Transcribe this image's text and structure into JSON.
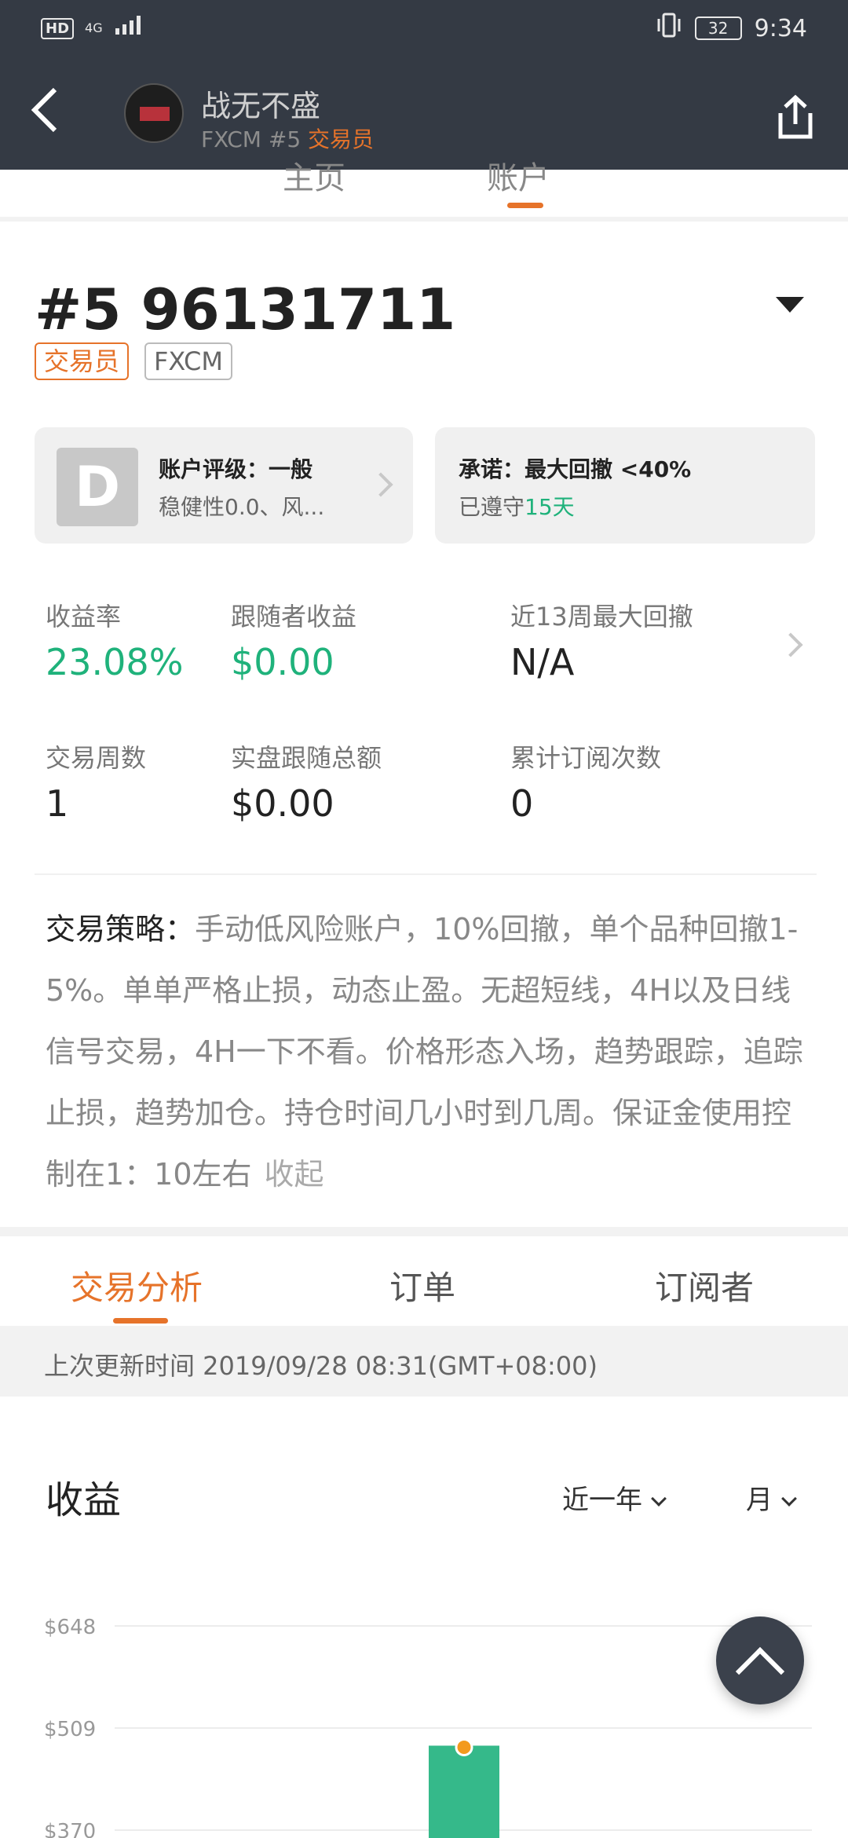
{
  "status_bar": {
    "network": "HD",
    "signal": "4G",
    "battery": "32",
    "time": "9:34"
  },
  "header": {
    "title": "战无不盛",
    "subtitle_prefix": "FXCM #5 ",
    "subtitle_role": "交易员",
    "back_icon": "chevron-left-icon",
    "share_icon": "share-icon"
  },
  "top_tabs": {
    "left_partial": "主页",
    "right_partial": "账户"
  },
  "account": {
    "id": "#5 96131711",
    "tags": [
      "交易员",
      "FXCM"
    ]
  },
  "rating_card": {
    "badge": "D",
    "title": "账户评级：一般",
    "subtitle": "稳健性0.0、风..."
  },
  "commitment_card": {
    "title": "承诺：最大回撤 <40%",
    "subtitle_prefix": "已遵守",
    "days": "15天"
  },
  "stats": [
    {
      "label": "收益率",
      "value": "23.08%"
    },
    {
      "label": "跟随者收益",
      "value": "$0.00"
    },
    {
      "label": "近13周最大回撤",
      "value": "N/A"
    },
    {
      "label": "交易周数",
      "value": "1"
    },
    {
      "label": "实盘跟随总额",
      "value": "$0.00"
    },
    {
      "label": "累计订阅次数",
      "value": "0"
    }
  ],
  "strategy": {
    "lead": "交易策略：",
    "text": "手动低风险账户，10%回撤，单个品种回撤1-5%。单单严格止损，动态止盈。无超短线，4H以及日线信号交易，4H一下不看。价格形态入场，趋势跟踪，追踪止损，趋势加仓。持仓时间几小时到几周。保证金使用控制在1：10左右",
    "collapse": "收起"
  },
  "section_tabs": [
    "交易分析",
    "订单",
    "订阅者"
  ],
  "update": {
    "text": "上次更新时间 2019/09/28 08:31(GMT+08:00)"
  },
  "chart": {
    "title": "收益",
    "range_select": "近一年",
    "period_select": "月"
  },
  "chart_data": {
    "type": "bar",
    "title": "收益",
    "y_ticks": [
      "$648",
      "$509",
      "$370"
    ],
    "ylim": [
      370,
      648
    ],
    "categories": [
      ""
    ],
    "values": [
      485
    ],
    "bar_color": "#35b98a",
    "marker_color": "#f39a1e"
  },
  "colors": {
    "accent": "#e6732a",
    "positive": "#1fb27b",
    "header_bg": "#343a44"
  }
}
